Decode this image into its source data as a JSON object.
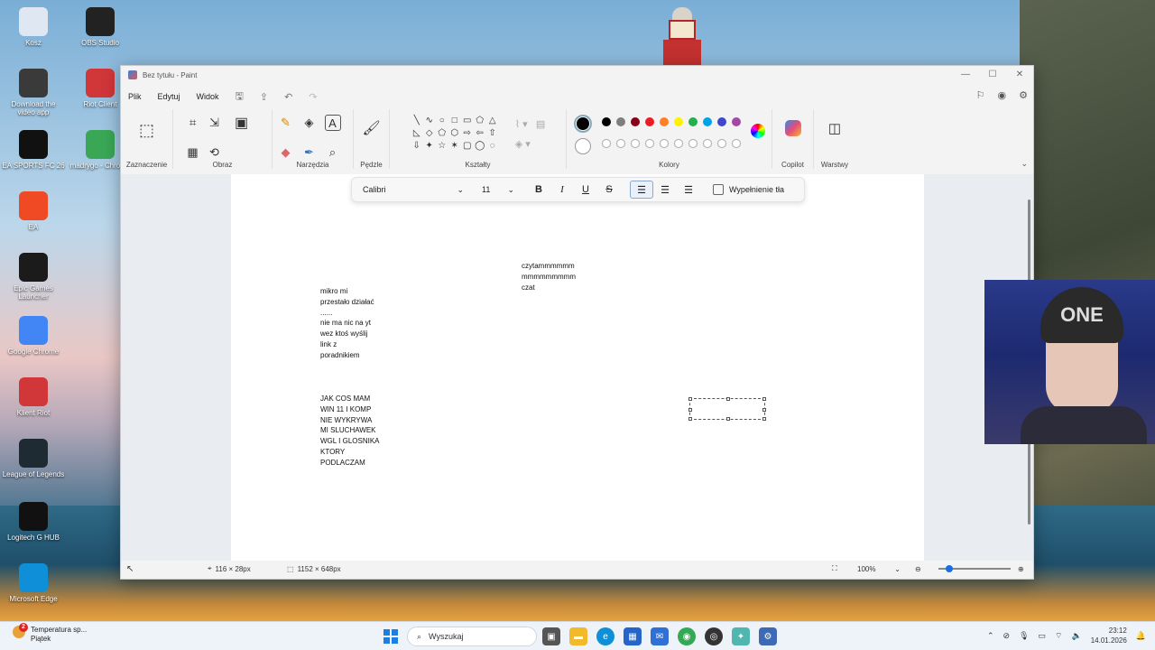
{
  "desktop": {
    "icons": [
      {
        "label": "Kosz",
        "icon": "recycle-bin-icon",
        "color": "#dfe8f2"
      },
      {
        "label": "OBS Studio",
        "icon": "obs-icon",
        "color": "#222222"
      },
      {
        "label": "Download the video app",
        "icon": "download-app-icon",
        "color": "#3a3a3a"
      },
      {
        "label": "Riot Client",
        "icon": "riot-client-icon",
        "color": "#d13639"
      },
      {
        "label": "EA SPORTS FC 26",
        "icon": "ea-fc-icon",
        "color": "#111111"
      },
      {
        "label": "madrygo - Chrome",
        "icon": "chrome-profile-icon",
        "color": "#3aa757"
      },
      {
        "label": "EA",
        "icon": "ea-icon",
        "color": "#f04a24"
      },
      {
        "label": "Epic Games Launcher",
        "icon": "epic-games-icon",
        "color": "#1b1b1b"
      },
      {
        "label": "Google Chrome",
        "icon": "chrome-icon",
        "color": "#4285f4"
      },
      {
        "label": "Klient Riot",
        "icon": "riot-client-icon",
        "color": "#d13639"
      },
      {
        "label": "League of Legends",
        "icon": "league-of-legends-icon",
        "color": "#1f2b33"
      },
      {
        "label": "Logitech G HUB",
        "icon": "logitech-icon",
        "color": "#111111"
      },
      {
        "label": "Microsoft Edge",
        "icon": "edge-icon",
        "color": "#0f8fd8"
      }
    ]
  },
  "window": {
    "title": "Bez tytułu - Paint",
    "controls": {
      "minimize": "—",
      "maximize": "☐",
      "close": "✕"
    }
  },
  "menu": {
    "file": "Plik",
    "edit": "Edytuj",
    "view": "Widok"
  },
  "ribbon": {
    "groups": {
      "selection": "Zaznaczenie",
      "image": "Obraz",
      "tools": "Narzędzia",
      "brushes": "Pędzle",
      "shapes": "Kształty",
      "colors": "Kolory",
      "copilot": "Copilot",
      "layers": "Warstwy"
    },
    "color_row1": [
      "#000000",
      "#7f7f7f",
      "#880015",
      "#ed1c24",
      "#ff7f27",
      "#fff200",
      "#22b14c",
      "#00a2e8",
      "#3f48cc",
      "#a349a4"
    ],
    "color_row2": [
      "#ffffff",
      "#c3c3c3",
      "#b97a57",
      "#ffaec9",
      "#ffc90e",
      "#efe4b0",
      "#b5e61d",
      "#99d9ea",
      "#7092be",
      "#c8bfe7"
    ],
    "primary_color": "#000000"
  },
  "textbar": {
    "font": "Calibri",
    "size": "11",
    "bold": "B",
    "italic": "I",
    "underline": "U",
    "strike": "S",
    "fill_label": "Wypełnienie tła"
  },
  "canvas": {
    "note_chat": "czytammmmmm\nmmmmmmmmm\nczat",
    "note_mic": "mikro mi\nprzestało działać\n......\nnie ma nic na yt\nwez ktoś wyślij\nlink z\nporadnikiem",
    "note_win": "JAK COS MAM\nWIN 11 I KOMP\nNIE WYKRYWA\nMI SLUCHAWEK\nWGL I GLOSNIKA\nKTORY\nPODLACZAM"
  },
  "status": {
    "cursor_pos": "116 × 28px",
    "canvas_size": "1152 × 648px",
    "zoom": "100%"
  },
  "taskbar": {
    "weather_title": "Temperatura sp...",
    "weather_sub": "Piątek",
    "weather_badge": "2",
    "search_placeholder": "Wyszukaj",
    "time": "23:12",
    "date": "14.01.2026"
  }
}
